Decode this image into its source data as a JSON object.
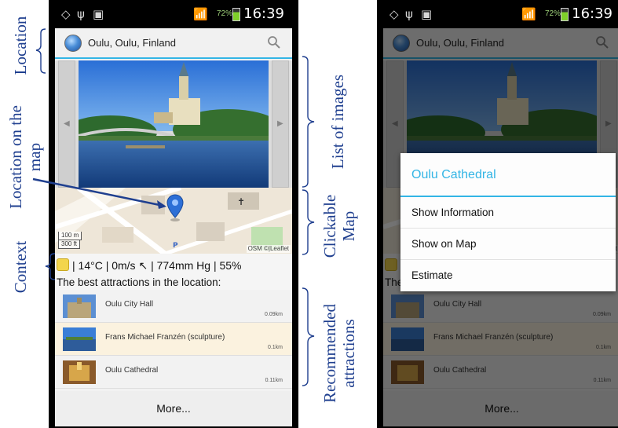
{
  "status_bar": {
    "time": "16:39",
    "battery_percent": "72%"
  },
  "location": {
    "title": "Oulu, Oulu, Finland"
  },
  "map": {
    "attribution": "OSM ©|Leaflet",
    "scale_metric": "100 m",
    "scale_imperial": "300 ft"
  },
  "context": {
    "line": "| 14°C | 0m/s ↖ | 774mm Hg | 55%"
  },
  "attractions_header": "The best attractions in the location:",
  "attractions": [
    {
      "name": "Oulu City Hall",
      "distance": "0.09km",
      "highlighted": false
    },
    {
      "name": "Frans Michael Franzén (sculpture)",
      "distance": "0.1km",
      "highlighted": true
    },
    {
      "name": "Oulu Cathedral",
      "distance": "0.11km",
      "highlighted": false
    }
  ],
  "more_label": "More...",
  "dialog": {
    "title": "Oulu Cathedral",
    "items": [
      "Show Information",
      "Show on Map",
      "Estimate"
    ]
  },
  "annotations": {
    "location": "Location",
    "location_on_map": "Location on the map",
    "context": "Context",
    "list_of_images": "List of images",
    "clickable_map": "Clickable Map",
    "recommended": "Recommended attractions"
  },
  "colors": {
    "accent": "#33b5e5",
    "annotation": "#1f3f8f",
    "highlight_row": "#fbf2df"
  }
}
